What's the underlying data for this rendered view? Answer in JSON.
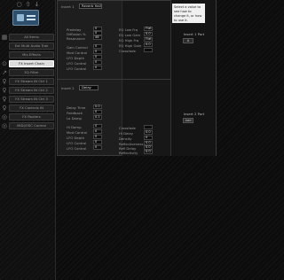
{
  "sidebar": {
    "top_icons": [
      "○",
      "⇧",
      "↓"
    ],
    "items": [
      {
        "label": "All Items",
        "icon": "▦",
        "active": false
      },
      {
        "label": "Ext Multi Audio Trak",
        "icon": "",
        "active": false
      },
      {
        "label": "Mix Effects",
        "icon": "",
        "active": false
      },
      {
        "label": "FX Insert Chain",
        "icon": "⊙",
        "active": true
      },
      {
        "label": "EQ Filter",
        "icon": "↗",
        "active": false
      },
      {
        "label": "FX Stream IN Ctrl 1",
        "icon": "♀",
        "active": false
      },
      {
        "label": "FX Stream IN Ctrl 2",
        "icon": "♀",
        "active": false
      },
      {
        "label": "FX Stream IN Ctrl 3",
        "icon": "♀",
        "active": false
      },
      {
        "label": "FX Controls IN",
        "icon": "♀",
        "active": false
      },
      {
        "label": "FX Routers",
        "icon": "◎",
        "active": false
      },
      {
        "label": "MIDI/OSC Control",
        "icon": "◎",
        "active": false
      }
    ]
  },
  "insert1": {
    "label": "Insert 1",
    "type": "Reverb Hall",
    "params_left": [
      {
        "label": "Predelay",
        "value": "0"
      },
      {
        "label": "Diffusion %",
        "value": "0"
      },
      {
        "label": "Resonance",
        "value": "48"
      },
      {
        "label": "Gain Control",
        "value": "0"
      },
      {
        "label": "Mod Control",
        "value": "0"
      },
      {
        "label": "LFO Depth",
        "value": "0"
      },
      {
        "label": "LFO Control",
        "value": "0"
      },
      {
        "label": "LFO Control",
        "value": "0"
      }
    ],
    "params_right": [
      {
        "label": "EQ Low Frq",
        "value": "Flat"
      },
      {
        "label": "EQ Low Gain",
        "value": "0.0"
      },
      {
        "label": "EQ High Frq",
        "value": "Flat"
      },
      {
        "label": "EQ High Gain",
        "value": "0.0"
      },
      {
        "label": "Crossfade",
        "value": ""
      }
    ]
  },
  "insert2": {
    "label": "Insert 2",
    "type": "Delay",
    "params_left": [
      {
        "label": "Delay Time",
        "value": "0.0"
      },
      {
        "label": "Feedback",
        "value": "0"
      },
      {
        "label": "Lo Damp",
        "value": "0.1"
      },
      {
        "label": "Hi Damp",
        "value": "0"
      },
      {
        "label": "Mod Control",
        "value": "0"
      },
      {
        "label": "LFO Depth",
        "value": "0"
      },
      {
        "label": "LFO Control",
        "value": "0"
      },
      {
        "label": "LFO Control",
        "value": "0"
      }
    ],
    "params_right": [
      {
        "label": "Crossfade",
        "value": ""
      },
      {
        "label": "Hi Delay",
        "value": "0.0"
      },
      {
        "label": "Density",
        "value": "0"
      },
      {
        "label": "Reflectiveness",
        "value": "0.0"
      },
      {
        "label": "Refl Delay",
        "value": "0.0"
      },
      {
        "label": "Reflectivity",
        "value": "0.0"
      }
    ]
  },
  "right_panel": {
    "info_text": "Select a value to see how to change it, or how to use it.",
    "port1_title": "Insert 1 Port",
    "port1_button": "A",
    "port2_title": "Insert 2 Port",
    "port2_button": "Add"
  }
}
